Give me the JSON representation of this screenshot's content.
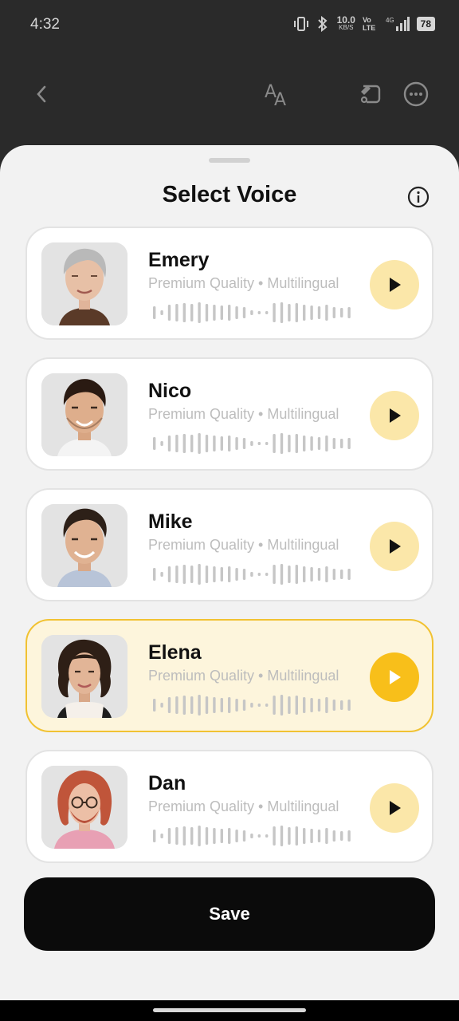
{
  "status_bar": {
    "time": "4:32",
    "network_speed": "10.0",
    "network_unit": "KB/S",
    "volte": "Vo LTE",
    "signal_label": "4G",
    "battery": "78"
  },
  "top_bar": {
    "back_icon": "chevron-left-icon",
    "text_size_icon": "text-size-icon",
    "share_icon": "share-icon",
    "more_icon": "more-icon"
  },
  "sheet": {
    "title": "Select Voice",
    "info_icon": "info-icon",
    "voices": [
      {
        "name": "Emery",
        "description": "Premium Quality • Multilingual",
        "selected": false
      },
      {
        "name": "Nico",
        "description": "Premium Quality • Multilingual",
        "selected": false
      },
      {
        "name": "Mike",
        "description": "Premium Quality • Multilingual",
        "selected": false
      },
      {
        "name": "Elena",
        "description": "Premium Quality • Multilingual",
        "selected": true
      },
      {
        "name": "Dan",
        "description": "Premium Quality • Multilingual",
        "selected": false
      }
    ],
    "save_label": "Save"
  },
  "colors": {
    "accent": "#f8bf1a",
    "accent_light": "#fbe7a9",
    "selected_card": "#fdf5dc",
    "save_button": "#0b0b0b"
  }
}
